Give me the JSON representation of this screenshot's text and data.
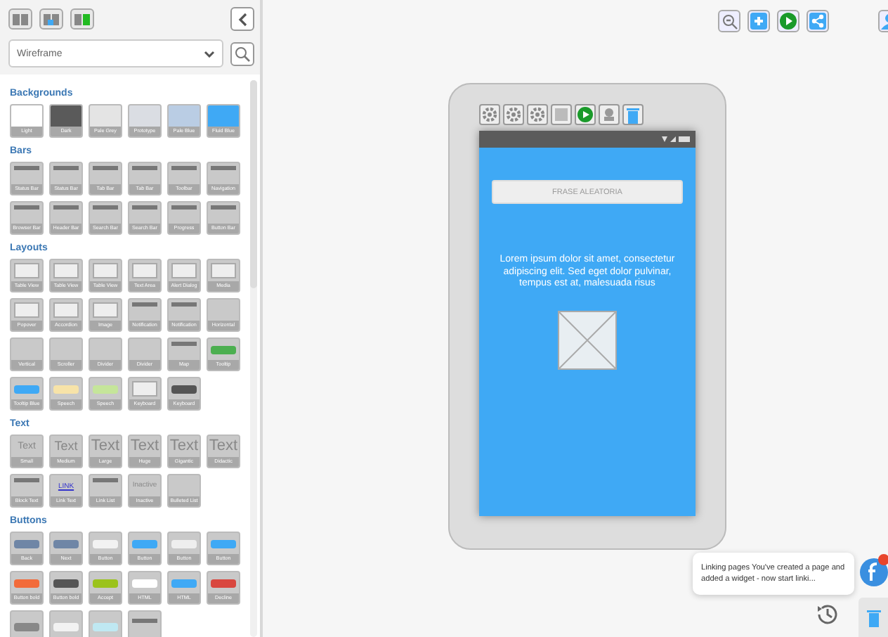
{
  "panel": {
    "dropdown": {
      "value": "Wireframe"
    },
    "sections": [
      {
        "title": "Backgrounds",
        "tiles": [
          {
            "label": "Light",
            "kind": "swatch",
            "color": "#ffffff"
          },
          {
            "label": "Dark",
            "kind": "swatch",
            "color": "#5a5a5a"
          },
          {
            "label": "Pale Grey",
            "kind": "swatch",
            "color": "#e4e4e4"
          },
          {
            "label": "Prototype",
            "kind": "swatch",
            "color": "#dadde3"
          },
          {
            "label": "Pale Blue",
            "kind": "swatch",
            "color": "#bacde4"
          },
          {
            "label": "Fluid Blue",
            "kind": "swatch",
            "color": "#3fa9f5"
          }
        ]
      },
      {
        "title": "Bars",
        "tiles": [
          {
            "label": "Status Bar",
            "kind": "bar"
          },
          {
            "label": "Status Bar",
            "kind": "bar"
          },
          {
            "label": "Tab Bar",
            "kind": "bar"
          },
          {
            "label": "Tab Bar",
            "kind": "bar"
          },
          {
            "label": "Toolbar",
            "kind": "bar"
          },
          {
            "label": "Navigation",
            "kind": "bar"
          },
          {
            "label": "Browser Bar",
            "kind": "bar"
          },
          {
            "label": "Header Bar",
            "kind": "bar"
          },
          {
            "label": "Search Bar",
            "kind": "bar"
          },
          {
            "label": "Search Bar",
            "kind": "bar"
          },
          {
            "label": "Progress",
            "kind": "bar"
          },
          {
            "label": "Button Bar",
            "kind": "bar"
          }
        ]
      },
      {
        "title": "Layouts",
        "tiles": [
          {
            "label": "Table View",
            "kind": "panel"
          },
          {
            "label": "Table View",
            "kind": "panel"
          },
          {
            "label": "Table View",
            "kind": "panel"
          },
          {
            "label": "Text Area",
            "kind": "panel"
          },
          {
            "label": "Alert Dialog",
            "kind": "panel"
          },
          {
            "label": "Media",
            "kind": "panel"
          },
          {
            "label": "Popover",
            "kind": "panel"
          },
          {
            "label": "Accordion",
            "kind": "panel"
          },
          {
            "label": "Image",
            "kind": "panel"
          },
          {
            "label": "Notification",
            "kind": "bar"
          },
          {
            "label": "Notification",
            "kind": "bar"
          },
          {
            "label": "Horizontal",
            "kind": "blank"
          },
          {
            "label": "Vertical",
            "kind": "blank"
          },
          {
            "label": "Scroller",
            "kind": "blank"
          },
          {
            "label": "Divider",
            "kind": "blank"
          },
          {
            "label": "Divider",
            "kind": "blank"
          },
          {
            "label": "Map",
            "kind": "bar"
          },
          {
            "label": "Tooltip",
            "kind": "button",
            "color": "#4caf50"
          },
          {
            "label": "Tooltip Blue",
            "kind": "button",
            "color": "#3fa9f5"
          },
          {
            "label": "Speech",
            "kind": "button",
            "color": "#f7e3a8"
          },
          {
            "label": "Speech",
            "kind": "button",
            "color": "#c5e59a"
          },
          {
            "label": "Keyboard",
            "kind": "panel"
          },
          {
            "label": "Keyboard",
            "kind": "button",
            "color": "#555555"
          }
        ]
      },
      {
        "title": "Text",
        "tiles": [
          {
            "label": "Small",
            "kind": "text",
            "sample": "Text"
          },
          {
            "label": "Medium",
            "kind": "text",
            "sample": "Text"
          },
          {
            "label": "Large",
            "kind": "text",
            "sample": "Text"
          },
          {
            "label": "Huge",
            "kind": "text",
            "sample": "Text"
          },
          {
            "label": "Gigantic",
            "kind": "text",
            "sample": "Text"
          },
          {
            "label": "Didactic",
            "kind": "text",
            "sample": "Text"
          },
          {
            "label": "Block Text",
            "kind": "bar"
          },
          {
            "label": "Link Text",
            "kind": "link",
            "sample": "LINK"
          },
          {
            "label": "Link List",
            "kind": "bar"
          },
          {
            "label": "Inactive",
            "kind": "text",
            "sample": "Inactive"
          },
          {
            "label": "Bulleted List",
            "kind": "blank"
          }
        ]
      },
      {
        "title": "Buttons",
        "tiles": [
          {
            "label": "Back",
            "kind": "button",
            "color": "#6f86a6"
          },
          {
            "label": "Next",
            "kind": "button",
            "color": "#6f86a6"
          },
          {
            "label": "Button",
            "kind": "button",
            "color": "#f2f2f2"
          },
          {
            "label": "Button",
            "kind": "button",
            "color": "#3fa9f5"
          },
          {
            "label": "Button",
            "kind": "button",
            "color": "#eeeeee"
          },
          {
            "label": "Button",
            "kind": "button",
            "color": "#3fa9f5"
          },
          {
            "label": "Button bold",
            "kind": "button",
            "color": "#f26b3a"
          },
          {
            "label": "Button bold",
            "kind": "button",
            "color": "#555555"
          },
          {
            "label": "Accept",
            "kind": "button",
            "color": "#9bc31c"
          },
          {
            "label": "HTML",
            "kind": "button",
            "color": "#ffffff"
          },
          {
            "label": "HTML",
            "kind": "button",
            "color": "#3fa9f5"
          },
          {
            "label": "Decline",
            "kind": "button",
            "color": "#d9473f"
          },
          {
            "kind": "button",
            "color": "#888888"
          },
          {
            "kind": "button",
            "color": "#f2f2f2"
          },
          {
            "kind": "button",
            "color": "#bfe8f2"
          },
          {
            "kind": "bar"
          }
        ]
      }
    ]
  },
  "device": {
    "field": {
      "placeholder": "FRASE ALEATORIA"
    },
    "paragraph": "Lorem ipsum dolor sit amet, consectetur adipiscing elit. Sed eget dolor pulvinar, tempus est at, malesuada risus"
  },
  "tip": {
    "text": "Linking pages You've created a page and added a widget - now start linki..."
  }
}
